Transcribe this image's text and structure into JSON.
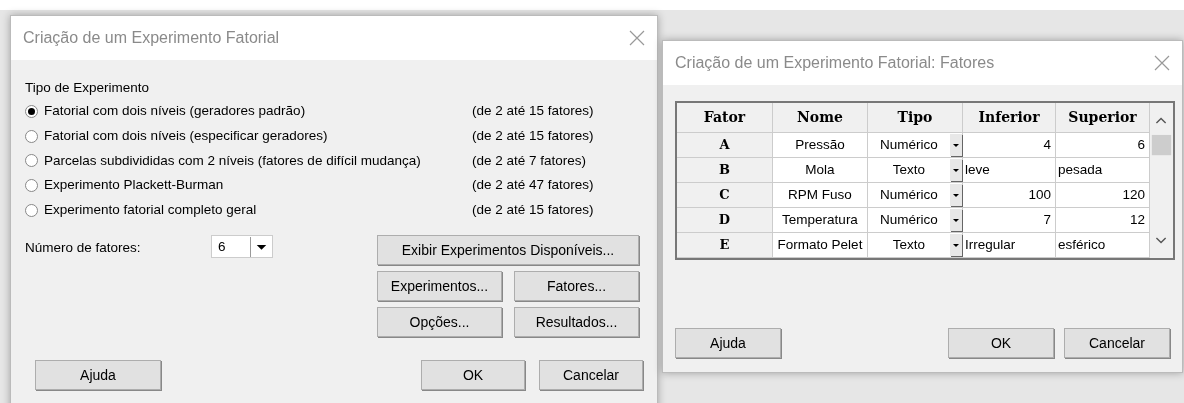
{
  "main_dialog": {
    "title": "Criação de um Experimento Fatorial",
    "group_label": "Tipo de Experimento",
    "experiment_types": [
      {
        "label": "Fatorial com dois níveis (geradores padrão)",
        "range": "(de 2 até 15 fatores)",
        "selected": true
      },
      {
        "label": "Fatorial com dois níveis (especificar geradores)",
        "range": "(de 2 até 15 fatores)",
        "selected": false
      },
      {
        "label": "Parcelas subdivididas com 2 níveis (fatores de difícil mudança)",
        "range": "(de 2 até 7 fatores)",
        "selected": false
      },
      {
        "label": "Experimento Plackett-Burman",
        "range": "(de 2 até 47 fatores)",
        "selected": false
      },
      {
        "label": "Experimento fatorial completo geral",
        "range": "(de 2 até 15 fatores)",
        "selected": false
      }
    ],
    "factor_count": {
      "label": "Número de fatores:",
      "value": "6"
    },
    "buttons": [
      "Exibir Experimentos Disponíveis...",
      "Experimentos...",
      "Fatores...",
      "Opções...",
      "Resultados..."
    ],
    "footer_buttons": [
      "Ajuda",
      "OK",
      "Cancelar"
    ]
  },
  "factors_dialog": {
    "title": "Criação de um Experimento Fatorial: Fatores",
    "table": {
      "columns": [
        "Fator",
        "Nome",
        "Tipo",
        "Inferior",
        "Superior"
      ],
      "rows": [
        {
          "kind": "numeric",
          "fator": "A",
          "nome": "Pressão",
          "tipo": "Numérico",
          "inferior": "4",
          "superior": "6"
        },
        {
          "kind": "text",
          "fator": "B",
          "nome": "Mola",
          "tipo": "Texto",
          "inferior": "leve",
          "superior": "pesada"
        },
        {
          "kind": "numeric",
          "fator": "C",
          "nome": "RPM Fuso",
          "tipo": "Numérico",
          "inferior": "100",
          "superior": "120"
        },
        {
          "kind": "numeric",
          "fator": "D",
          "nome": "Temperatura",
          "tipo": "Numérico",
          "inferior": "7",
          "superior": "12"
        },
        {
          "kind": "text",
          "fator": "E",
          "nome": "Formato Pelet",
          "tipo": "Texto",
          "inferior": "Irregular",
          "superior": "esférico"
        }
      ]
    },
    "footer_buttons": [
      "Ajuda",
      "OK",
      "Cancelar"
    ]
  }
}
